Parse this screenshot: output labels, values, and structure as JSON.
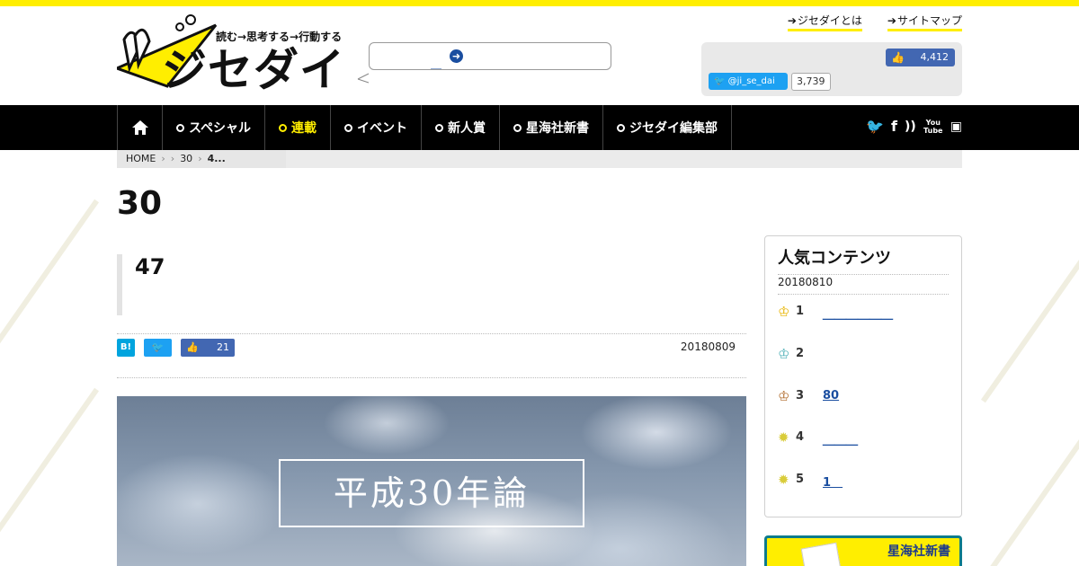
{
  "header": {
    "tagline": "読む→思考する→行動する",
    "logo_text": "ジセダイ",
    "search_placeholder": "",
    "search_link_text": "＿",
    "search_button_icon": "arrow-right-circle-icon",
    "top_links": [
      {
        "label": "ジセダイとは"
      },
      {
        "label": "サイトマップ"
      }
    ],
    "facebook_count": "4,412",
    "twitter_handle": "@ji_se_dai",
    "twitter_count": "3,739"
  },
  "nav": {
    "items": [
      {
        "label": "スペシャル"
      },
      {
        "label": "連載"
      },
      {
        "label": "イベント"
      },
      {
        "label": "新人賞"
      },
      {
        "label": "星海社新書"
      },
      {
        "label": "ジセダイ編集部"
      }
    ],
    "social_icons": [
      "twitter-icon",
      "facebook-icon",
      "rss-icon",
      "youtube-icon",
      "app-icon"
    ],
    "youtube_label": "You Tube"
  },
  "breadcrumb": {
    "home": "HOME",
    "level2": "30",
    "current": "4..."
  },
  "page": {
    "title": "30",
    "article_title": "47",
    "hatena_label": "B!",
    "facebook_share_count": "21",
    "date": "20180809",
    "hero_text": "平成30年論"
  },
  "sidebar": {
    "ranking_title": "人気コンテンツ",
    "ranking_date": "20180810",
    "items": [
      {
        "rank": "1",
        "text": "＿＿＿＿＿＿",
        "icon": "gold-crown-icon",
        "color": "#e8b400"
      },
      {
        "rank": "2",
        "text": "",
        "icon": "silver-crown-icon",
        "color": "#4fb0b8"
      },
      {
        "rank": "3",
        "text": "80",
        "icon": "bronze-crown-icon",
        "color": "#b06a2a"
      },
      {
        "rank": "4",
        "text": "＿＿＿",
        "icon": "star-badge-icon",
        "color": "#d9cc3a"
      },
      {
        "rank": "5",
        "text": "1　",
        "icon": "star-badge-icon",
        "color": "#d9cc3a"
      }
    ],
    "banner_text": "星海社新書"
  },
  "colors": {
    "accent": "#ffee00",
    "nav_bg": "#000000",
    "link": "#1a4ea0",
    "facebook": "#4267b2",
    "twitter": "#1da1f2"
  }
}
